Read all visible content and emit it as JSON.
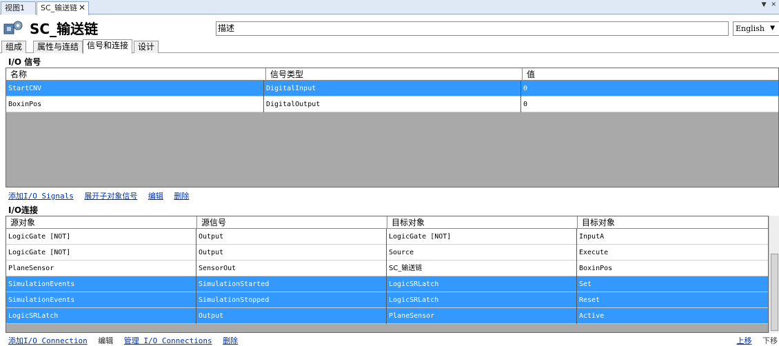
{
  "doc_tabs": [
    {
      "label": "视图1"
    },
    {
      "label": "SC_输送链",
      "close": "✕"
    }
  ],
  "doc_menu": {
    "pin": "▼",
    "close": "✕"
  },
  "header": {
    "title": "SC_输送链",
    "description_value": "描述",
    "language": "English"
  },
  "inner_tabs": [
    "组成",
    "属性与连结",
    "信号和连接",
    "设计"
  ],
  "io_signals": {
    "section_title": "I/O 信号",
    "columns": [
      "名称",
      "信号类型",
      "值"
    ],
    "rows": [
      {
        "name": "StartCNV",
        "type": "DigitalInput",
        "value": "0",
        "selected": true
      },
      {
        "name": "BoxinPos",
        "type": "DigitalOutput",
        "value": "0",
        "selected": false
      }
    ],
    "actions": [
      "添加I/O Signals",
      "展开子对象信号",
      "编辑",
      "删除"
    ]
  },
  "io_connections": {
    "section_title": "I/O连接",
    "columns": [
      "源对象",
      "源信号",
      "目标对象",
      "目标对象"
    ],
    "rows": [
      {
        "src": "LogicGate [NOT]",
        "signal": "Output",
        "target": "LogicGate [NOT]",
        "target_signal": "InputA",
        "selected": false
      },
      {
        "src": "LogicGate [NOT]",
        "signal": "Output",
        "target": "Source",
        "target_signal": "Execute",
        "selected": false
      },
      {
        "src": "PlaneSensor",
        "signal": "SensorOut",
        "target": "SC_输送链",
        "target_signal": "BoxinPos",
        "selected": false
      },
      {
        "src": "SimulationEvents",
        "signal": "SimulationStarted",
        "target": "LogicSRLatch",
        "target_signal": "Set",
        "selected": true
      },
      {
        "src": "SimulationEvents",
        "signal": "SimulationStopped",
        "target": "LogicSRLatch",
        "target_signal": "Reset",
        "selected": true
      },
      {
        "src": "LogicSRLatch",
        "signal": "Output",
        "target": "PlaneSensor",
        "target_signal": "Active",
        "selected": true
      }
    ],
    "actions": [
      {
        "label": "添加I/O Connection",
        "enabled": true
      },
      {
        "label": "编辑",
        "enabled": false
      },
      {
        "label": "管理 I/O Connections",
        "enabled": true
      },
      {
        "label": "删除",
        "enabled": true
      }
    ],
    "move_up": "上移",
    "move_down": "下移"
  },
  "colors": {
    "selection": "#3399ff",
    "empty_area": "#a9a9a9",
    "link": "#0033aa"
  }
}
